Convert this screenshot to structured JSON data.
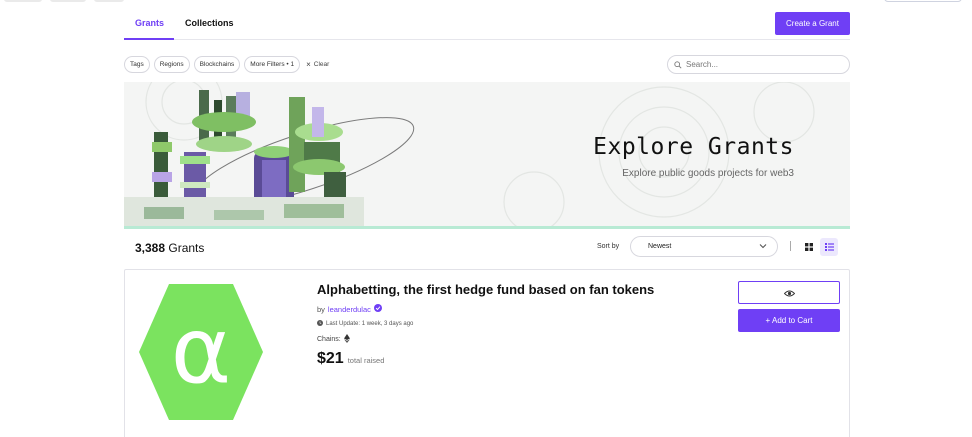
{
  "tabs": [
    {
      "label": "Grants",
      "active": true
    },
    {
      "label": "Collections",
      "active": false
    }
  ],
  "header": {
    "create_label": "Create a Grant"
  },
  "filters": {
    "chips": [
      "Tags",
      "Regions",
      "Blockchains",
      "More Filters • 1"
    ],
    "clear_label": "Clear"
  },
  "search": {
    "placeholder": "Search..."
  },
  "banner": {
    "title": "Explore Grants",
    "subtitle": "Explore public goods projects for web3"
  },
  "results": {
    "count": "3,388",
    "count_suffix": " Grants"
  },
  "sort": {
    "label": "Sort by",
    "value": "Newest"
  },
  "grant": {
    "title": "Alphabetting, the first hedge fund based on fan tokens",
    "by_prefix": "by",
    "author": "leanderdulac",
    "last_update": "Last Update: 1 week, 3 days ago",
    "chains_label": "Chains:",
    "amount": "$21",
    "amount_label": "total raised",
    "cart_label": "+ Add to Cart",
    "logo_glyph": "α"
  },
  "colors": {
    "accent": "#6f3ff5",
    "logo_green": "#7be35f",
    "banner_line": "#b8ead4"
  },
  "icons": [
    "search-icon",
    "close-icon",
    "chevron-down-icon",
    "grid-view-icon",
    "list-view-icon",
    "verified-badge-icon",
    "clock-icon",
    "ethereum-icon",
    "eye-icon"
  ]
}
